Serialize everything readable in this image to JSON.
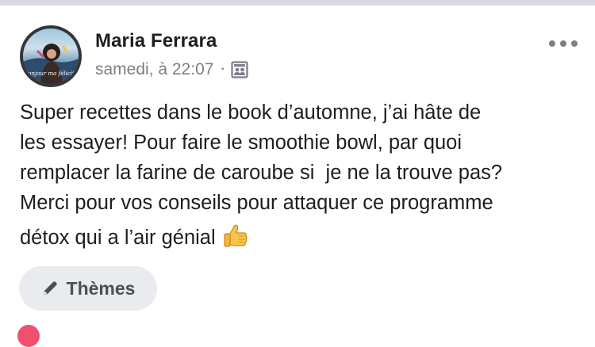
{
  "post": {
    "author": {
      "name": "Maria Ferrara",
      "avatar_icon": "profile-photo",
      "avatar_caption": "Bonjour ma félicité"
    },
    "timestamp": "samedi, à 22:07",
    "separator": "·",
    "audience_icon": "group-members-icon",
    "more_icon": "more-horizontal-icon",
    "text": "Super recettes dans le book d’automne, j’ai hâte de\nles essayer! Pour faire le smoothie bowl, par quoi\nremplacer la farine de caroube si  je ne la trouve pas?\nMerci pour vos conseils pour attaquer ce programme\n",
    "text_last_line": "détox qui a l’air génial",
    "emoji": "thumbs-up-emoji"
  },
  "topics": {
    "icon": "pencil-icon",
    "label": "Thèmes"
  },
  "colors": {
    "name": "#1c1e21",
    "meta": "#7c7f85",
    "chip_bg": "#e9ebee",
    "chip_text": "#4b4f56"
  }
}
